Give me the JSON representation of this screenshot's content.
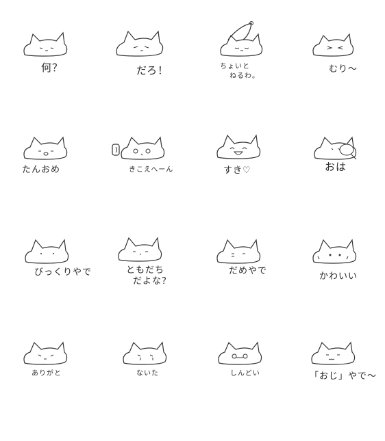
{
  "stickers": [
    {
      "label": "何？"
    },
    {
      "label": "だろ！"
    },
    {
      "label": "ちょいと",
      "label2": "ねるわ。"
    },
    {
      "label": "むり～"
    },
    {
      "label": "たんおめ"
    },
    {
      "label": "きこえへーん"
    },
    {
      "label": "すき♡"
    },
    {
      "label": "おは"
    },
    {
      "label": "びっくりやで"
    },
    {
      "label": "ともだち",
      "label2": "だよな？"
    },
    {
      "label": "だめやで"
    },
    {
      "label": "かわいい"
    },
    {
      "label": "ありがと"
    },
    {
      "label": "ないた"
    },
    {
      "label": "しんどい"
    },
    {
      "label": "「おじ」やで～"
    }
  ]
}
